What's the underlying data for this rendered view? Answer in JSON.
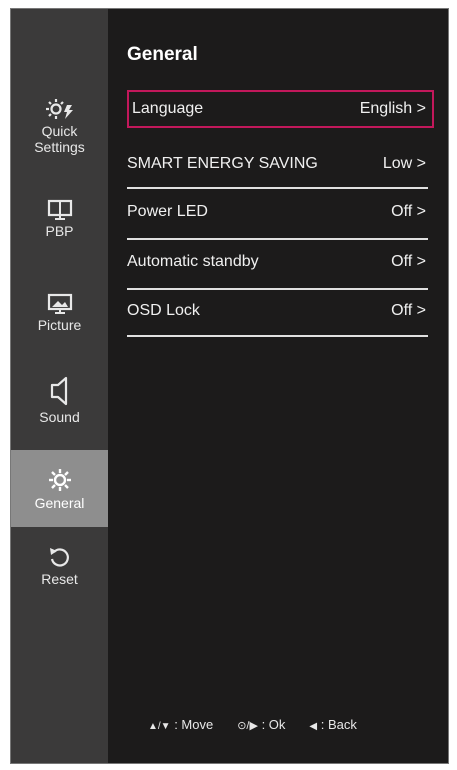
{
  "sidebar": {
    "items": [
      {
        "label_line1": "Quick",
        "label_line2": "Settings",
        "icon": "quick-settings-icon",
        "active": false
      },
      {
        "label": "PBP",
        "icon": "pbp-icon",
        "active": false
      },
      {
        "label": "Picture",
        "icon": "picture-icon",
        "active": false
      },
      {
        "label": "Sound",
        "icon": "sound-icon",
        "active": false
      },
      {
        "label": "General",
        "icon": "gear-icon",
        "active": true
      },
      {
        "label": "Reset",
        "icon": "reset-icon",
        "active": false
      }
    ]
  },
  "main": {
    "title": "General",
    "rows": [
      {
        "label": "Language",
        "value": "English",
        "chevron": ">",
        "selected": true
      },
      {
        "label": "SMART ENERGY SAVING",
        "value": "Low",
        "chevron": ">",
        "selected": false
      },
      {
        "label": "Power LED",
        "value": "Off",
        "chevron": ">",
        "selected": false
      },
      {
        "label": "Automatic standby",
        "value": "Off",
        "chevron": ">",
        "selected": false
      },
      {
        "label": "OSD Lock",
        "value": "Off",
        "chevron": ">",
        "selected": false
      }
    ]
  },
  "footer": {
    "move_keys": "▲/▼",
    "move_label": ": Move",
    "ok_keys": "⊙/▶",
    "ok_label": ": Ok",
    "back_key": "◀",
    "back_label": ": Back"
  },
  "colors": {
    "background": "#1c1b1b",
    "sidebar": "#3b3a3a",
    "active_item": "#8e8e8e",
    "selection_border": "#c2185b"
  }
}
